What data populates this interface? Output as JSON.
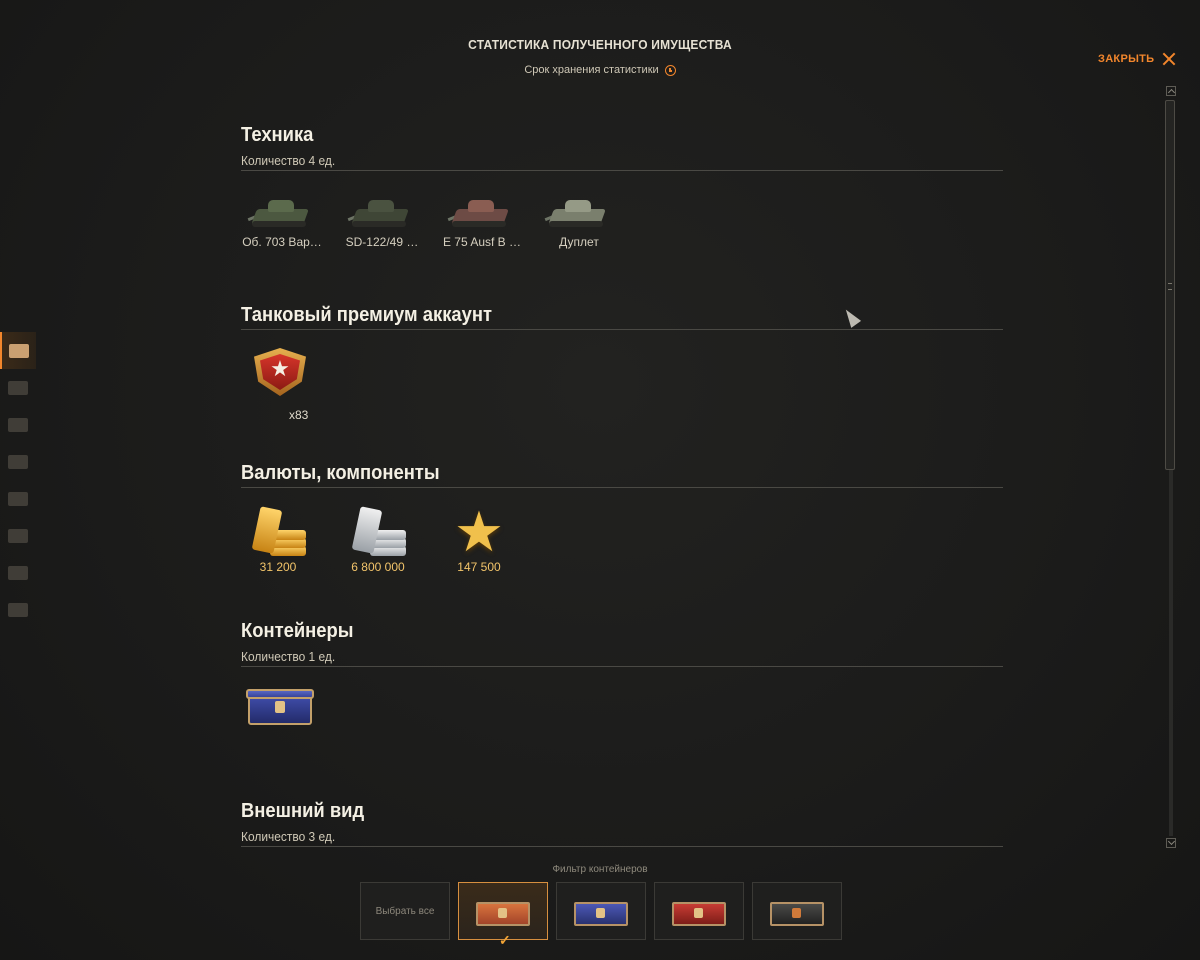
{
  "header": {
    "title": "СТАТИСТИКА ПОЛУЧЕННОГО ИМУЩЕСТВА",
    "subtitle": "Срок хранения статистики",
    "close_label": "ЗАКРЫТЬ"
  },
  "sections": {
    "vehicles": {
      "title": "Техника",
      "count": "Количество 4 ед.",
      "items": [
        {
          "label": "Об. 703 Вар…"
        },
        {
          "label": "SD-122/49 …"
        },
        {
          "label": "E 75 Ausf B …"
        },
        {
          "label": "Дуплет"
        }
      ]
    },
    "premium": {
      "title": "Танковый премиум аккаунт",
      "quantity": "x83"
    },
    "currencies": {
      "title": "Валюты, компоненты",
      "items": [
        {
          "value": "31 200",
          "icon": "gold-icon"
        },
        {
          "value": "6 800 000",
          "icon": "credits-icon"
        },
        {
          "value": "147 500",
          "icon": "free-xp-icon"
        }
      ]
    },
    "containers": {
      "title": "Контейнеры",
      "count": "Количество 1 ед."
    },
    "appearance": {
      "title": "Внешний вид",
      "count": "Количество 3 ед."
    }
  },
  "filter": {
    "label": "Фильтр контейнеров",
    "select_all": "Выбрать все",
    "selected_index": 1
  },
  "colors": {
    "accent": "#f2862c",
    "currency_text": "#f2c46a",
    "background": "#1c1c1b"
  }
}
